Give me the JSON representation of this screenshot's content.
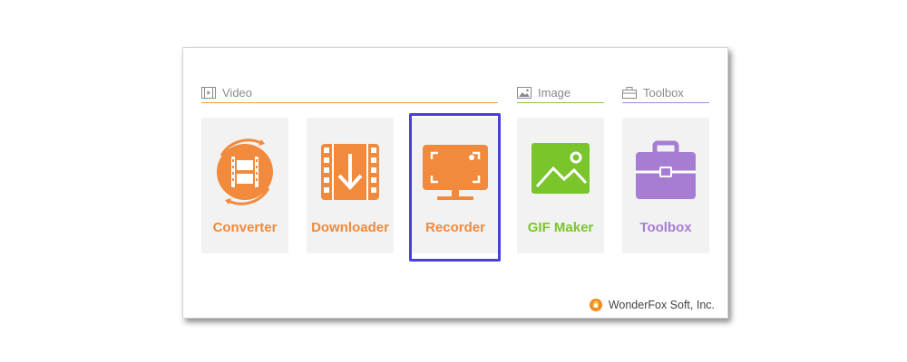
{
  "sections": {
    "video": {
      "label": "Video",
      "color": "#f39c4a"
    },
    "image": {
      "label": "Image",
      "color": "#8bc34a"
    },
    "toolbox": {
      "label": "Toolbox",
      "color": "#a984d6"
    }
  },
  "tiles": [
    {
      "label": "Converter",
      "icon": "film-reel-icon",
      "color": "#f18a3c"
    },
    {
      "label": "Downloader",
      "icon": "download-film-icon",
      "color": "#f18a3c"
    },
    {
      "label": "Recorder",
      "icon": "screen-record-icon",
      "color": "#f18a3c",
      "selected": true
    },
    {
      "label": "GIF Maker",
      "icon": "image-landscape-icon",
      "color": "#7ac52b"
    },
    {
      "label": "Toolbox",
      "icon": "toolbox-icon",
      "color": "#a77dd4"
    }
  ],
  "highlight_color": "#4a3fd8",
  "footer": {
    "brand": "WonderFox Soft, Inc."
  }
}
